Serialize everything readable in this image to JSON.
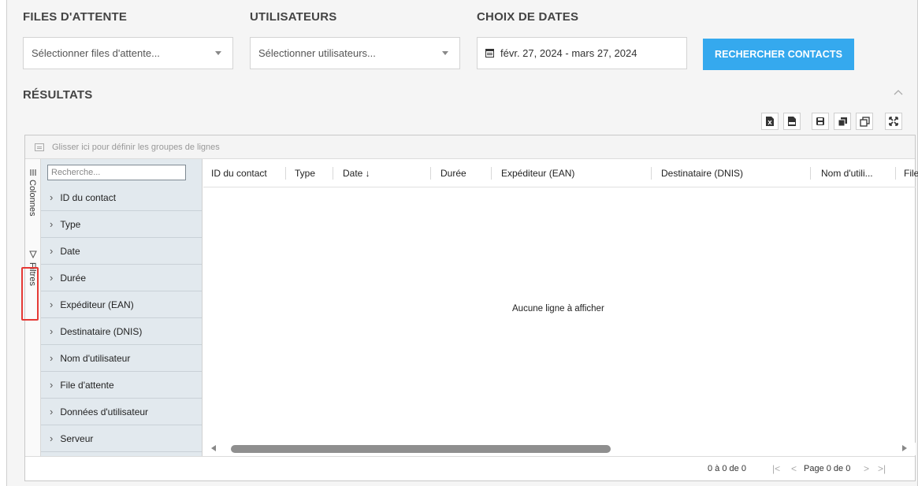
{
  "filters": {
    "queues_title": "FILES D'ATTENTE",
    "queues_placeholder": "Sélectionner files d'attente...",
    "users_title": "UTILISATEURS",
    "users_placeholder": "Sélectionner utilisateurs...",
    "dates_title": "CHOIX DE DATES",
    "date_range": "févr. 27, 2024 - mars 27, 2024",
    "search_button": "RECHERCHER CONTACTS"
  },
  "results": {
    "title": "RÉSULTATS",
    "toolbar_icons": [
      "export-excel-icon",
      "export-csv-icon",
      "save-icon",
      "copy-icon",
      "restore-icon",
      "fullscreen-icon"
    ]
  },
  "grid": {
    "group_bar_text": "Glisser ici pour définir les groupes de lignes",
    "side_tabs": {
      "columns": "Colonnes",
      "filters": "Filtres"
    },
    "column_search_placeholder": "Recherche...",
    "column_list": [
      "ID du contact",
      "Type",
      "Date",
      "Durée",
      "Expéditeur (EAN)",
      "Destinataire (DNIS)",
      "Nom d'utilisateur",
      "File d'attente",
      "Données d'utilisateur",
      "Serveur"
    ],
    "headers": [
      "ID du contact",
      "Type",
      "Date ↓",
      "Durée",
      "Expéditeur (EAN)",
      "Destinataire (DNIS)",
      "Nom d'utili...",
      "File"
    ],
    "empty_message": "Aucune ligne à afficher",
    "footer": {
      "range": "0 à 0 de 0",
      "page": "Page 0 de 0"
    }
  },
  "colors": {
    "accent": "#35a9ee",
    "highlight": "#e53935",
    "column_panel": "#e2e9ee"
  }
}
